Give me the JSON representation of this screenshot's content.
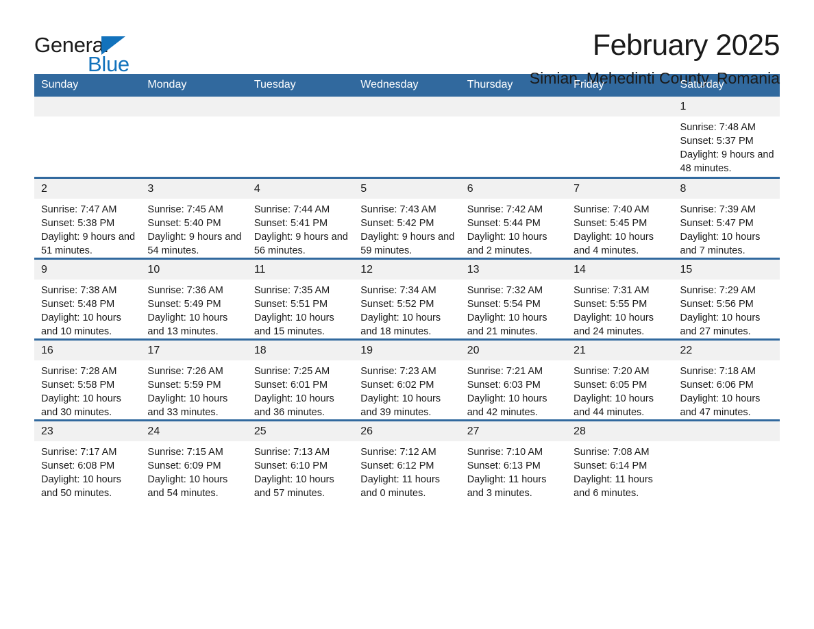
{
  "brand": {
    "name_part1": "General",
    "name_part2": "Blue",
    "triangle_icon": "triangle-icon",
    "accent_color": "#1272bc"
  },
  "header": {
    "month_title": "February 2025",
    "location": "Simian, Mehedinti County, Romania"
  },
  "theme": {
    "header_blue": "#31699e",
    "daynum_gray": "#f1f1f1",
    "text": "#1a1a1a"
  },
  "calendar": {
    "weekday_headers": [
      "Sunday",
      "Monday",
      "Tuesday",
      "Wednesday",
      "Thursday",
      "Friday",
      "Saturday"
    ],
    "weeks": [
      [
        {
          "day": "",
          "blank": true
        },
        {
          "day": "",
          "blank": true
        },
        {
          "day": "",
          "blank": true
        },
        {
          "day": "",
          "blank": true
        },
        {
          "day": "",
          "blank": true
        },
        {
          "day": "",
          "blank": true
        },
        {
          "day": "1",
          "sunrise": "Sunrise: 7:48 AM",
          "sunset": "Sunset: 5:37 PM",
          "daylight": "Daylight: 9 hours and 48 minutes."
        }
      ],
      [
        {
          "day": "2",
          "sunrise": "Sunrise: 7:47 AM",
          "sunset": "Sunset: 5:38 PM",
          "daylight": "Daylight: 9 hours and 51 minutes."
        },
        {
          "day": "3",
          "sunrise": "Sunrise: 7:45 AM",
          "sunset": "Sunset: 5:40 PM",
          "daylight": "Daylight: 9 hours and 54 minutes."
        },
        {
          "day": "4",
          "sunrise": "Sunrise: 7:44 AM",
          "sunset": "Sunset: 5:41 PM",
          "daylight": "Daylight: 9 hours and 56 minutes."
        },
        {
          "day": "5",
          "sunrise": "Sunrise: 7:43 AM",
          "sunset": "Sunset: 5:42 PM",
          "daylight": "Daylight: 9 hours and 59 minutes."
        },
        {
          "day": "6",
          "sunrise": "Sunrise: 7:42 AM",
          "sunset": "Sunset: 5:44 PM",
          "daylight": "Daylight: 10 hours and 2 minutes."
        },
        {
          "day": "7",
          "sunrise": "Sunrise: 7:40 AM",
          "sunset": "Sunset: 5:45 PM",
          "daylight": "Daylight: 10 hours and 4 minutes."
        },
        {
          "day": "8",
          "sunrise": "Sunrise: 7:39 AM",
          "sunset": "Sunset: 5:47 PM",
          "daylight": "Daylight: 10 hours and 7 minutes."
        }
      ],
      [
        {
          "day": "9",
          "sunrise": "Sunrise: 7:38 AM",
          "sunset": "Sunset: 5:48 PM",
          "daylight": "Daylight: 10 hours and 10 minutes."
        },
        {
          "day": "10",
          "sunrise": "Sunrise: 7:36 AM",
          "sunset": "Sunset: 5:49 PM",
          "daylight": "Daylight: 10 hours and 13 minutes."
        },
        {
          "day": "11",
          "sunrise": "Sunrise: 7:35 AM",
          "sunset": "Sunset: 5:51 PM",
          "daylight": "Daylight: 10 hours and 15 minutes."
        },
        {
          "day": "12",
          "sunrise": "Sunrise: 7:34 AM",
          "sunset": "Sunset: 5:52 PM",
          "daylight": "Daylight: 10 hours and 18 minutes."
        },
        {
          "day": "13",
          "sunrise": "Sunrise: 7:32 AM",
          "sunset": "Sunset: 5:54 PM",
          "daylight": "Daylight: 10 hours and 21 minutes."
        },
        {
          "day": "14",
          "sunrise": "Sunrise: 7:31 AM",
          "sunset": "Sunset: 5:55 PM",
          "daylight": "Daylight: 10 hours and 24 minutes."
        },
        {
          "day": "15",
          "sunrise": "Sunrise: 7:29 AM",
          "sunset": "Sunset: 5:56 PM",
          "daylight": "Daylight: 10 hours and 27 minutes."
        }
      ],
      [
        {
          "day": "16",
          "sunrise": "Sunrise: 7:28 AM",
          "sunset": "Sunset: 5:58 PM",
          "daylight": "Daylight: 10 hours and 30 minutes."
        },
        {
          "day": "17",
          "sunrise": "Sunrise: 7:26 AM",
          "sunset": "Sunset: 5:59 PM",
          "daylight": "Daylight: 10 hours and 33 minutes."
        },
        {
          "day": "18",
          "sunrise": "Sunrise: 7:25 AM",
          "sunset": "Sunset: 6:01 PM",
          "daylight": "Daylight: 10 hours and 36 minutes."
        },
        {
          "day": "19",
          "sunrise": "Sunrise: 7:23 AM",
          "sunset": "Sunset: 6:02 PM",
          "daylight": "Daylight: 10 hours and 39 minutes."
        },
        {
          "day": "20",
          "sunrise": "Sunrise: 7:21 AM",
          "sunset": "Sunset: 6:03 PM",
          "daylight": "Daylight: 10 hours and 42 minutes."
        },
        {
          "day": "21",
          "sunrise": "Sunrise: 7:20 AM",
          "sunset": "Sunset: 6:05 PM",
          "daylight": "Daylight: 10 hours and 44 minutes."
        },
        {
          "day": "22",
          "sunrise": "Sunrise: 7:18 AM",
          "sunset": "Sunset: 6:06 PM",
          "daylight": "Daylight: 10 hours and 47 minutes."
        }
      ],
      [
        {
          "day": "23",
          "sunrise": "Sunrise: 7:17 AM",
          "sunset": "Sunset: 6:08 PM",
          "daylight": "Daylight: 10 hours and 50 minutes."
        },
        {
          "day": "24",
          "sunrise": "Sunrise: 7:15 AM",
          "sunset": "Sunset: 6:09 PM",
          "daylight": "Daylight: 10 hours and 54 minutes."
        },
        {
          "day": "25",
          "sunrise": "Sunrise: 7:13 AM",
          "sunset": "Sunset: 6:10 PM",
          "daylight": "Daylight: 10 hours and 57 minutes."
        },
        {
          "day": "26",
          "sunrise": "Sunrise: 7:12 AM",
          "sunset": "Sunset: 6:12 PM",
          "daylight": "Daylight: 11 hours and 0 minutes."
        },
        {
          "day": "27",
          "sunrise": "Sunrise: 7:10 AM",
          "sunset": "Sunset: 6:13 PM",
          "daylight": "Daylight: 11 hours and 3 minutes."
        },
        {
          "day": "28",
          "sunrise": "Sunrise: 7:08 AM",
          "sunset": "Sunset: 6:14 PM",
          "daylight": "Daylight: 11 hours and 6 minutes."
        },
        {
          "day": "",
          "blank": true
        }
      ]
    ]
  }
}
